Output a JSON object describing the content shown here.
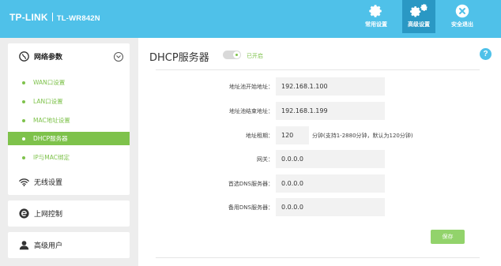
{
  "header": {
    "brand": "TP-LINK",
    "model": "TL-WR842N",
    "buttons": [
      {
        "label": "常用设置",
        "icon": "gear-icon"
      },
      {
        "label": "高级设置",
        "icon": "gears-icon"
      },
      {
        "label": "安全退出",
        "icon": "exit-icon"
      }
    ]
  },
  "sidebar": {
    "sections": [
      {
        "label": "网络参数",
        "icon": "network-icon"
      },
      {
        "label": "无线设置",
        "icon": "wifi-icon"
      },
      {
        "label": "上网控制",
        "icon": "internet-control-icon"
      },
      {
        "label": "高级用户",
        "icon": "user-icon"
      }
    ],
    "items": [
      {
        "label": "WAN口设置"
      },
      {
        "label": "LAN口设置"
      },
      {
        "label": "MAC地址设置"
      },
      {
        "label": "DHCP服务器"
      },
      {
        "label": "IP与MAC绑定"
      }
    ]
  },
  "main": {
    "title": "DHCP服务器",
    "status": "已开启",
    "help": "?",
    "fields": [
      {
        "label": "地址池开始地址：",
        "value": "192.168.1.100"
      },
      {
        "label": "地址池结束地址：",
        "value": "192.168.1.199"
      },
      {
        "label": "地址租期：",
        "value": "120"
      },
      {
        "label": "网关：",
        "value": "0.0.0.0"
      },
      {
        "label": "首选DNS服务器：",
        "value": "0.0.0.0"
      },
      {
        "label": "备用DNS服务器：",
        "value": "0.0.0.0"
      }
    ],
    "lease_hint": "分钟(支持1-2880分钟，默认为120分钟)",
    "save_label": "保存"
  },
  "colors": {
    "header_bg": "#4fc1e9",
    "header_active": "#2a98c4",
    "accent_green": "#7ec24b",
    "save_green": "#92d36b"
  }
}
